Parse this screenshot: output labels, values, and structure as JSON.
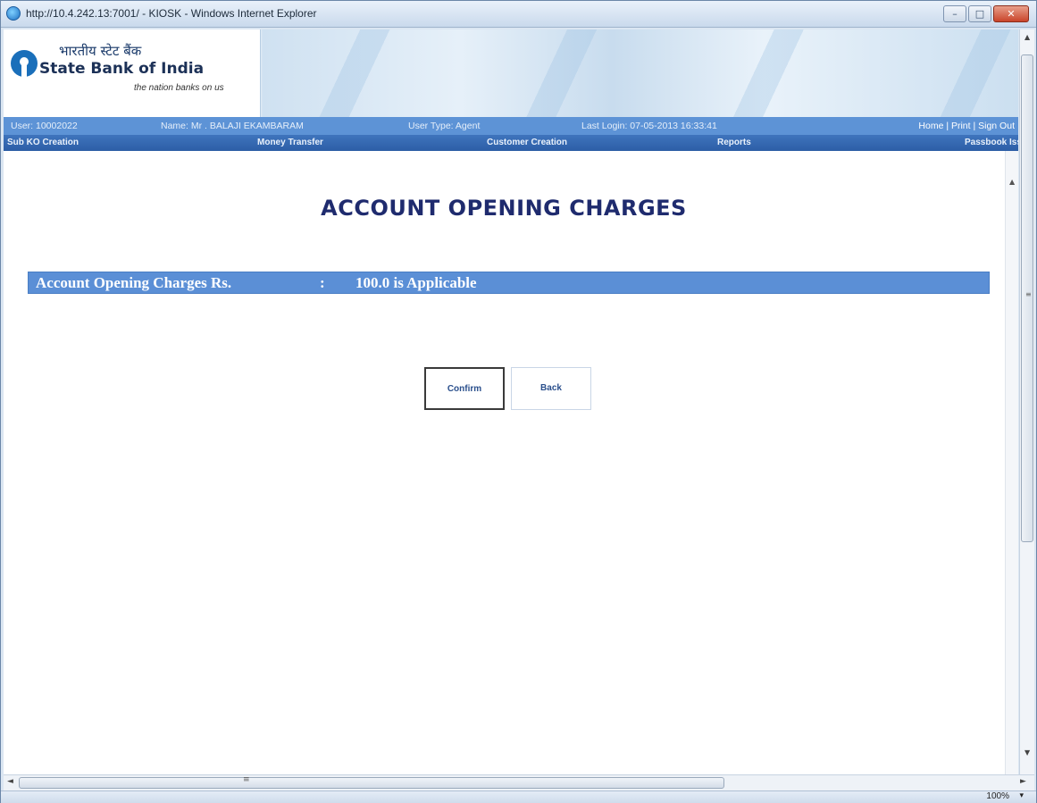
{
  "window": {
    "title": "http://10.4.242.13:7001/ - KIOSK - Windows Internet Explorer",
    "controls": {
      "minimize": "–",
      "maximize": "□",
      "close": "✕"
    }
  },
  "header": {
    "hindi_name": "भारतीय स्टेट बैंक",
    "bank_name": "State Bank of India",
    "tagline": "the nation banks on us"
  },
  "infobar": {
    "user": "User: 10002022",
    "name": "Name: Mr . BALAJI EKAMBARAM",
    "user_type": "User Type: Agent",
    "last_login": "Last Login: 07-05-2013 16:33:41",
    "links": "Home | Print | Sign Out"
  },
  "nav": {
    "items": [
      "Sub KO Creation",
      "Money Transfer",
      "Customer Creation",
      "Reports",
      "Passbook Iss"
    ]
  },
  "main": {
    "title": "ACCOUNT OPENING CHARGES",
    "charges_label": "Account Opening Charges Rs.",
    "charges_separator": ":",
    "charges_value": "100.0 is Applicable",
    "confirm_label": "Confirm",
    "back_label": "Back"
  },
  "statusbar": {
    "zoom": "100%",
    "zoom_dropdown": "▾"
  },
  "icons": {
    "scroll_up": "▲",
    "scroll_down": "▼",
    "scroll_left": "◄",
    "scroll_right": "►",
    "grip": "≡"
  },
  "colors": {
    "accent": "#5b8fd6",
    "nav": "#2d5ea6",
    "title": "#1f2b6e"
  }
}
